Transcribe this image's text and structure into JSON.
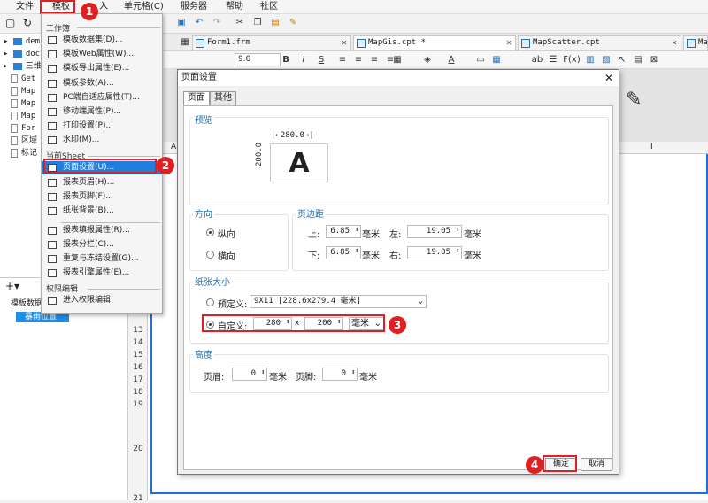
{
  "menubar": {
    "items": [
      "文件",
      "模板",
      "入",
      "单元格(C)",
      "服务器",
      "帮助",
      "社区"
    ]
  },
  "tabs": [
    {
      "label": "Form1.frm"
    },
    {
      "label": "MapGis.cpt *"
    },
    {
      "label": "MapScatter.cpt"
    },
    {
      "label": "Map"
    }
  ],
  "toolbar2": {
    "font_size": "9.0",
    "bold": "B",
    "italic": "I",
    "underline": "S",
    "abc": "ab",
    "fx": "F(x)"
  },
  "tree": {
    "items": [
      "dem",
      "doc",
      "三维",
      "Get",
      "Map",
      "Map",
      "Map",
      "For",
      "区域",
      "标记"
    ]
  },
  "lower_left": {
    "label": "模板数据",
    "selected": "暴雨位置"
  },
  "dropdown": {
    "section1": "工作簿",
    "items1": [
      "模板数据集(D)...",
      "模板Web属性(W)...",
      "模板导出属性(E)...",
      "模板参数(A)...",
      "PC端自适应属性(T)...",
      "移动端属性(P)...",
      "打印设置(P)...",
      "水印(M)..."
    ],
    "section2": "当前Sheet",
    "items2": [
      "页面设置(U)...",
      "报表页眉(H)...",
      "报表页脚(F)...",
      "纸张背景(B)..."
    ],
    "items3": [
      "报表填报属性(R)...",
      "报表分栏(C)...",
      "重复与冻结设置(G)...",
      "报表引擎属性(E)..."
    ],
    "section3": "权限编辑",
    "items4": [
      "进入权限编辑"
    ]
  },
  "dialog": {
    "title": "页面设置",
    "tabs": [
      "页面",
      "其他"
    ],
    "preview": {
      "label": "预览",
      "width": "280.0",
      "height": "200.0",
      "letter": "A"
    },
    "orientation": {
      "label": "方向",
      "portrait": "纵向",
      "landscape": "横向"
    },
    "margins": {
      "label": "页边距",
      "top_label": "上:",
      "top": "6.85",
      "bottom_label": "下:",
      "bottom": "6.85",
      "left_label": "左:",
      "left": "19.05",
      "right_label": "右:",
      "right": "19.05",
      "unit": "毫米"
    },
    "paper": {
      "label": "纸张大小",
      "preset_label": "预定义:",
      "preset_value": "9X11 [228.6x279.4 毫米]",
      "custom_label": "自定义:",
      "custom_w": "280",
      "x": "x",
      "custom_h": "200",
      "unit": "毫米"
    },
    "height": {
      "label": "高度",
      "header_label": "页眉:",
      "header": "0",
      "footer_label": "页脚:",
      "footer": "0",
      "unit": "毫米"
    },
    "ok": "确定",
    "cancel": "取消"
  },
  "rows": [
    "13",
    "14",
    "15",
    "16",
    "17",
    "18",
    "19",
    "20",
    "21"
  ],
  "colhdr": {
    "a": "A",
    "i": "I"
  },
  "callouts": [
    "1",
    "2",
    "3",
    "4"
  ]
}
